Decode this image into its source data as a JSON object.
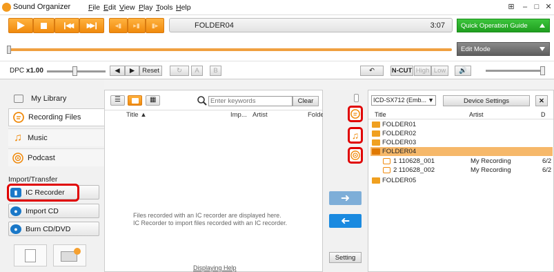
{
  "titlebar": {
    "title": "Sound Organizer",
    "menus": [
      "File",
      "Edit",
      "View",
      "Play",
      "Tools",
      "Help"
    ]
  },
  "player": {
    "track": "FOLDER04",
    "time": "3:07",
    "quick_guide": "Quick Operation Guide",
    "edit_mode": "Edit Mode"
  },
  "controls": {
    "dpc_label": "DPC",
    "dpc_value": "x1.00",
    "reset": "Reset",
    "ncut": "N-CUT",
    "high": "High",
    "low": "Low",
    "a": "A",
    "b": "B"
  },
  "sidebar": {
    "my_library": "My Library",
    "items": [
      {
        "label": "Recording Files"
      },
      {
        "label": "Music"
      },
      {
        "label": "Podcast"
      }
    ],
    "section": "Import/Transfer",
    "buttons": [
      {
        "label": "IC Recorder"
      },
      {
        "label": "Import CD"
      },
      {
        "label": "Burn CD/DVD"
      }
    ]
  },
  "library": {
    "search_placeholder": "Enter keywords",
    "clear": "Clear",
    "columns": [
      "Title",
      "Imp...",
      "Artist",
      "Folde"
    ],
    "empty_line1": "Files recorded with an IC recorder are displayed here.",
    "empty_line2": "IC Recorder to import files recorded with an IC recorder.",
    "help_link": "Displaying Help"
  },
  "middle": {
    "setting": "Setting"
  },
  "device": {
    "name": "ICD-SX712 (Emb...",
    "settings": "Device Settings",
    "columns": [
      "Title",
      "Artist",
      "D"
    ],
    "rows": [
      {
        "title": "FOLDER01",
        "artist": "",
        "date": ""
      },
      {
        "title": "FOLDER02",
        "artist": "",
        "date": ""
      },
      {
        "title": "FOLDER03",
        "artist": "",
        "date": ""
      },
      {
        "title": "FOLDER04",
        "artist": "",
        "date": ""
      },
      {
        "title": "1  110628_001",
        "artist": "My Recording",
        "date": "6/2"
      },
      {
        "title": "2  110628_002",
        "artist": "My Recording",
        "date": "6/2"
      },
      {
        "title": "FOLDER05",
        "artist": "",
        "date": ""
      }
    ]
  }
}
